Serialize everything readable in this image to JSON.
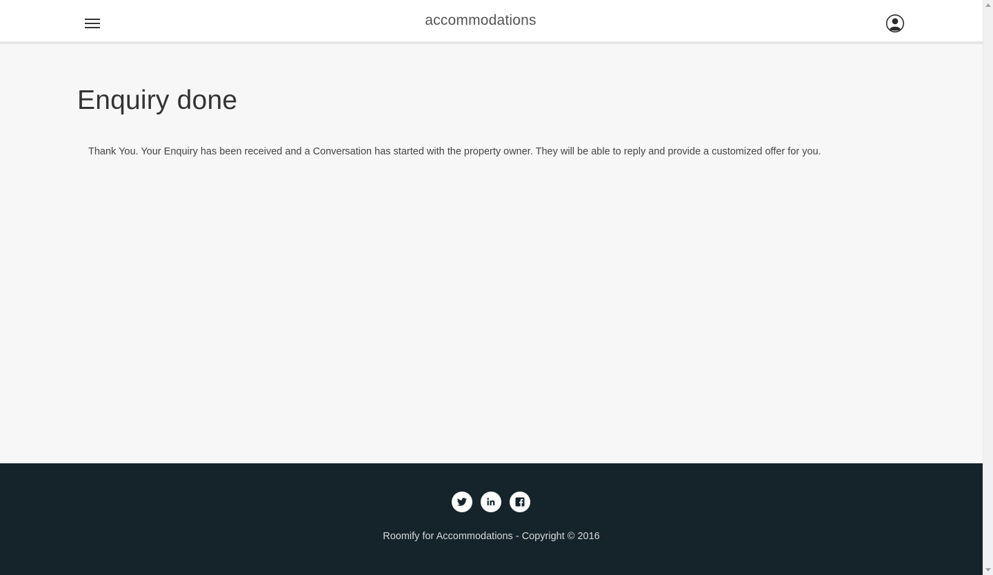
{
  "header": {
    "brand": "accommodations",
    "menu_icon": "hamburger-menu-icon",
    "user_icon": "user-account-icon"
  },
  "main": {
    "title": "Enquiry done",
    "message": "Thank You. Your Enquiry has been received and a Conversation has started with the property owner. They will be able to reply and provide a customized offer for you."
  },
  "footer": {
    "social_icons": [
      "twitter-icon",
      "linkedin-icon",
      "facebook-icon"
    ],
    "copyright": "Roomify for Accommodations - Copyright © 2016"
  },
  "colors": {
    "page_background": "#f7f7f7",
    "header_background": "#ffffff",
    "footer_background": "#15242b",
    "text": "#333333"
  }
}
